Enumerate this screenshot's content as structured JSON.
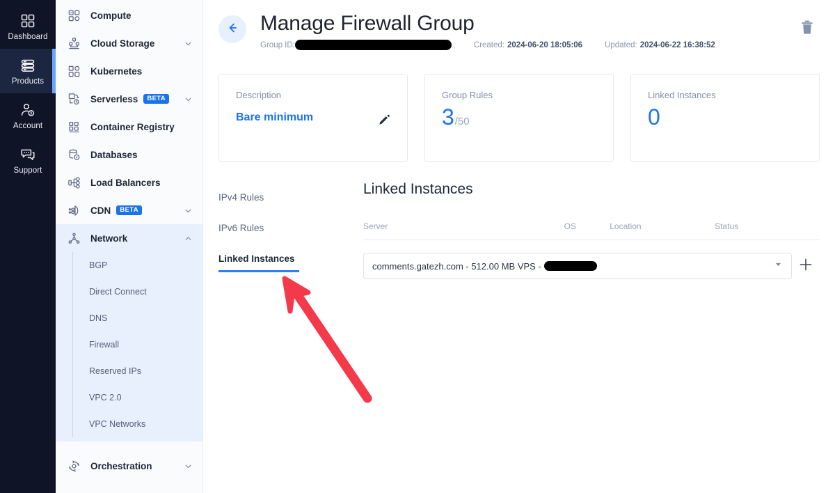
{
  "rail": {
    "items": [
      {
        "label": "Dashboard",
        "icon": "dashboard-grid-icon",
        "active": false
      },
      {
        "label": "Products",
        "icon": "server-stack-icon",
        "active": true
      },
      {
        "label": "Account",
        "icon": "user-key-icon",
        "active": false
      },
      {
        "label": "Support",
        "icon": "chat-bubbles-icon",
        "active": false
      }
    ]
  },
  "nav": {
    "items": [
      {
        "label": "Compute",
        "icon": "compute-icon",
        "badge": null,
        "chevron": null
      },
      {
        "label": "Cloud Storage",
        "icon": "cloud-storage-icon",
        "badge": null,
        "chevron": "down"
      },
      {
        "label": "Kubernetes",
        "icon": "kubernetes-icon",
        "badge": null,
        "chevron": null
      },
      {
        "label": "Serverless",
        "icon": "serverless-icon",
        "badge": "BETA",
        "chevron": "down"
      },
      {
        "label": "Container Registry",
        "icon": "container-registry-icon",
        "badge": null,
        "chevron": null
      },
      {
        "label": "Databases",
        "icon": "databases-icon",
        "badge": null,
        "chevron": null
      },
      {
        "label": "Load Balancers",
        "icon": "load-balancers-icon",
        "badge": null,
        "chevron": null
      },
      {
        "label": "CDN",
        "icon": "cdn-icon",
        "badge": "BETA",
        "chevron": "down"
      }
    ],
    "network": {
      "label": "Network",
      "icon": "network-nodes-icon",
      "chevron": "up",
      "sub": [
        "BGP",
        "Direct Connect",
        "DNS",
        "Firewall",
        "Reserved IPs",
        "VPC 2.0",
        "VPC Networks"
      ]
    },
    "orchestration": {
      "label": "Orchestration",
      "icon": "orchestration-icon",
      "chevron": "down"
    }
  },
  "header": {
    "back_icon": "arrow-left-icon",
    "title": "Manage Firewall Group",
    "group_id_label": "Group ID:",
    "group_id_value": "",
    "created_label": "Created:",
    "created_value": "2024-06-20 18:05:06",
    "updated_label": "Updated:",
    "updated_value": "2024-06-22 16:38:52",
    "delete_icon": "trash-icon"
  },
  "cards": [
    {
      "label": "Description",
      "value": "Bare minimum",
      "kind": "text",
      "edit_icon": "pencil-icon"
    },
    {
      "label": "Group Rules",
      "value": "3",
      "suffix": "/50",
      "kind": "number"
    },
    {
      "label": "Linked Instances",
      "value": "0",
      "suffix": "",
      "kind": "number"
    }
  ],
  "tabs": [
    {
      "label": "IPv4 Rules",
      "active": false
    },
    {
      "label": "IPv6 Rules",
      "active": false
    },
    {
      "label": "Linked Instances",
      "active": true
    }
  ],
  "panel": {
    "title": "Linked Instances",
    "columns": [
      "Server",
      "OS",
      "Location",
      "Status"
    ],
    "selected_instance": "comments.gatezh.com - 512.00 MB VPS - ",
    "caret_icon": "chevron-down-icon",
    "add_icon": "plus-icon"
  },
  "annotation": {
    "arrow_color": "#f4394a",
    "name": "red-pointer-arrow"
  },
  "colors": {
    "accent": "#1a73e8",
    "rail_bg": "#0f1426",
    "rail_active": "#1d2640",
    "rail_indicator": "#6aa4fb",
    "nav_bg": "#fafbfd",
    "nav_active": "#e8f0fd",
    "red": "#f4394a"
  }
}
